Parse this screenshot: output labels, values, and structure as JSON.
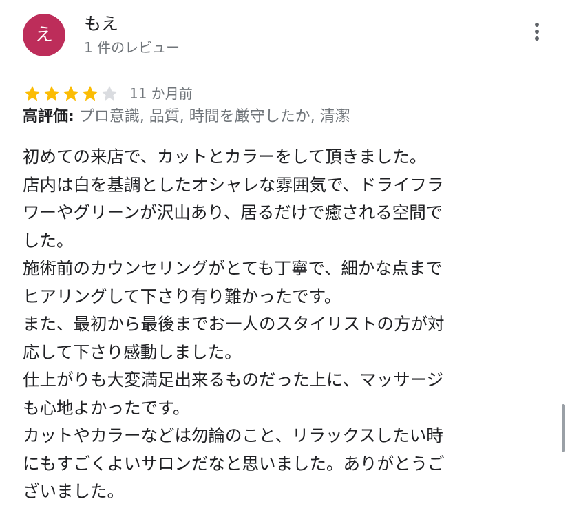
{
  "review": {
    "author": {
      "initial": "え",
      "name": "もえ",
      "review_count": "1 件のレビュー",
      "avatar_color": "#bd2d5a"
    },
    "menu_icon": "more-vert-icon",
    "rating": 4,
    "rating_max": 5,
    "star_color": "#fbbc04",
    "star_empty_color": "#dadce0",
    "date": "11 か月前",
    "highlights_label": "高評価:",
    "highlights_values": "プロ意識, 品質, 時間を厳守したか, 清潔",
    "body_lines": [
      "初めての来店で、カットとカラーをして頂きました。",
      "店内は白を基調としたオシャレな雰囲気で、ドライフラ",
      "ワーやグリーンが沢山あり、居るだけで癒される空間で",
      "した。",
      "施術前のカウンセリングがとても丁寧で、細かな点まで",
      "ヒアリングして下さり有り難かったです。",
      "また、最初から最後までお一人のスタイリストの方が対",
      "応して下さり感動しました。",
      "仕上がりも大変満足出来るものだった上に、マッサージ",
      "も心地よかったです。",
      "カットやカラーなどは勿論のこと、リラックスしたい時",
      "にもすごくよいサロンだなと思いました。ありがとうご",
      "ざいました。"
    ]
  }
}
